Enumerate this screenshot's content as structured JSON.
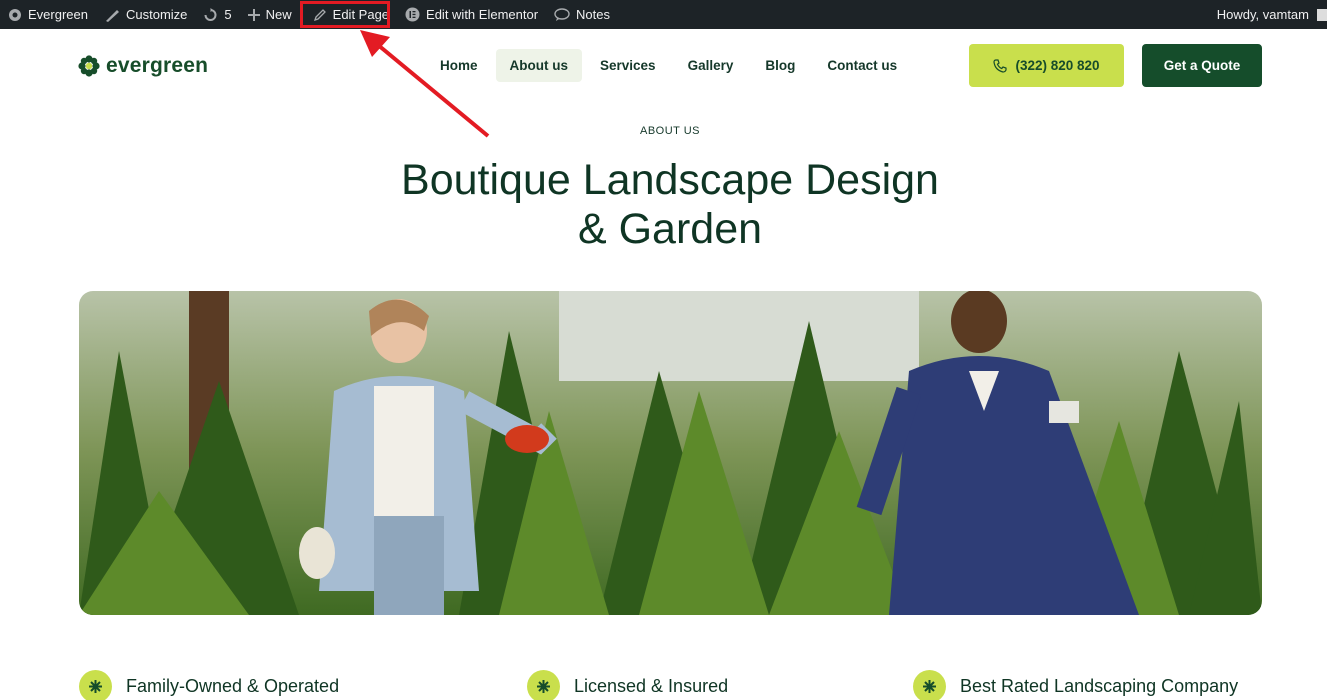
{
  "adminbar": {
    "site": "Evergreen",
    "customize": "Customize",
    "updates": "5",
    "new": "New",
    "edit_page": "Edit Page",
    "elementor": "Edit with Elementor",
    "notes": "Notes",
    "howdy": "Howdy, vamtam"
  },
  "header": {
    "logo": "evergreen",
    "nav": [
      "Home",
      "About us",
      "Services",
      "Gallery",
      "Blog",
      "Contact us"
    ],
    "active_nav": "About us",
    "phone": "(322) 820 820",
    "quote": "Get a Quote"
  },
  "hero": {
    "eyebrow": "ABOUT US",
    "title_line1": "Boutique Landscape Design",
    "title_line2": "& Garden"
  },
  "features": [
    {
      "label": "Family-Owned & Operated"
    },
    {
      "label": "Licensed & Insured"
    },
    {
      "label": "Best Rated Landscaping Company"
    }
  ],
  "colors": {
    "brand_green": "#154d2b",
    "accent_lime": "#c9df4c",
    "adminbar_bg": "#1d2327",
    "highlight_red": "#e31b23"
  }
}
